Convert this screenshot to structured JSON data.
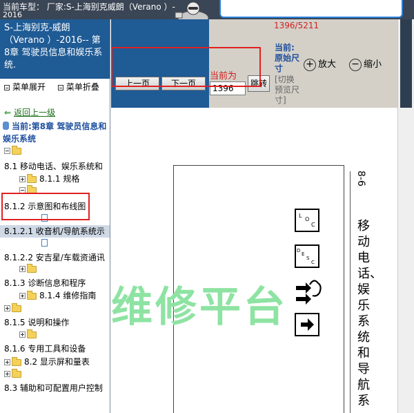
{
  "topbar": {
    "text": "当前车型： 厂家:S-上海别克威朗（Verano ）-",
    "text2": "2016"
  },
  "sidebar": {
    "title": "S-上海别克-威朗 （Verano ）-2016-- 第8章 驾驶员信息和娱乐系统.",
    "expand_label": "菜单展开",
    "collapse_label": "菜单折叠",
    "back_label": "返回上一级",
    "current_label": "当前:第8章 驾驶员信息和娱乐系统",
    "tree": [
      {
        "label": "",
        "kind": "root"
      },
      {
        "label": "8.1 移动电话、娱乐系统和",
        "kind": "text"
      },
      {
        "label": "8.1.1 规格",
        "kind": "folder"
      },
      {
        "label": "",
        "kind": "folder-empty"
      },
      {
        "label": "8.1.2 示意图和布线图",
        "kind": "text"
      },
      {
        "label": "",
        "kind": "doc"
      },
      {
        "label": "8.1.2.1 收音机/导航系统示",
        "kind": "text-selected"
      },
      {
        "label": "",
        "kind": "doc"
      },
      {
        "label": "8.1.2.2 安吉星/车载资通讯",
        "kind": "text"
      },
      {
        "label": "",
        "kind": "folder-empty"
      },
      {
        "label": "8.1.3 诊断信息和程序",
        "kind": "text"
      },
      {
        "label": "8.1.4 维修指南",
        "kind": "folder"
      },
      {
        "label": "",
        "kind": "folder-empty"
      },
      {
        "label": "8.1.5 说明和操作",
        "kind": "text"
      },
      {
        "label": "",
        "kind": "folder-empty"
      },
      {
        "label": "8.1.6 专用工具和设备",
        "kind": "text"
      },
      {
        "label": "8.2 显示屏和量表",
        "kind": "folder"
      },
      {
        "label": "",
        "kind": "folder-empty"
      },
      {
        "label": "8.3 辅助和可配置用户控制",
        "kind": "text"
      }
    ]
  },
  "toolbar": {
    "prev_label": "上一页",
    "next_label": "下一页",
    "current_page_label": "当前为",
    "current_page_value": "1396",
    "jump_label": "跳转",
    "page_count": "1396/5211",
    "current_size_prefix": "当前:",
    "current_size": "原始尺寸",
    "switch_size": "[切换预览尺寸]",
    "zoom_in_label": "放大",
    "zoom_out_label": "缩小"
  },
  "document": {
    "page_number": "8-6",
    "heading": "移动电话、娱乐系统和导航系",
    "watermark": "维修平台",
    "icons": [
      {
        "name": "loc-icon",
        "text": "LOC"
      },
      {
        "name": "desc-icon",
        "text": "DESC"
      },
      {
        "name": "hand-arrows-icon",
        "text": ""
      },
      {
        "name": "right-arrow-icon",
        "text": ""
      }
    ]
  },
  "colors": {
    "topbar_bg": "#3a4555",
    "sidebar_title_bg": "#1f5b95",
    "highlight_red": "#e02020",
    "watermark_green": "#8ee3a3"
  }
}
